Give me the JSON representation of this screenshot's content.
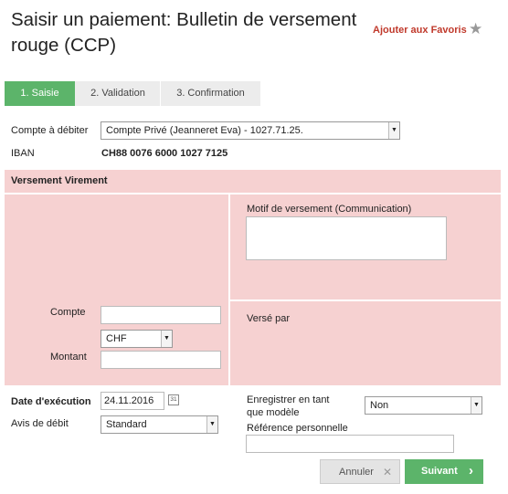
{
  "page_title": "Saisir un paiement: Bulletin de versement rouge (CCP)",
  "favorites_label": "Ajouter aux Favoris",
  "steps": [
    {
      "label": "1. Saisie"
    },
    {
      "label": "2. Validation"
    },
    {
      "label": "3. Confirmation"
    }
  ],
  "debit_account": {
    "label": "Compte à débiter",
    "value": "Compte Privé (Jeanneret Eva) - 1027.71.25."
  },
  "iban": {
    "label": "IBAN",
    "value": "CH88 0076 6000 1027 7125"
  },
  "section_title": "Versement Virement",
  "motif": {
    "label": "Motif de versement (Communication)",
    "value": ""
  },
  "verse_par": {
    "label": "Versé par"
  },
  "compte": {
    "label": "Compte",
    "value": ""
  },
  "currency": {
    "value": "CHF"
  },
  "montant": {
    "label": "Montant",
    "value": ""
  },
  "execution_date": {
    "label": "Date d'exécution",
    "value": "24.11.2016",
    "calendar_icon_text": "31"
  },
  "avis_debit": {
    "label": "Avis de débit",
    "value": "Standard"
  },
  "save_template": {
    "label_line1": "Enregistrer en tant",
    "label_line2": "que modèle",
    "value": "Non"
  },
  "reference": {
    "label": "Référence personnelle",
    "value": ""
  },
  "buttons": {
    "cancel": "Annuler",
    "cancel_icon": "✕",
    "next": "Suivant",
    "next_icon": "›"
  },
  "colors": {
    "accent_green": "#5cb46a",
    "pink_panel": "#f6d1d1",
    "fav_red": "#c0392b"
  }
}
